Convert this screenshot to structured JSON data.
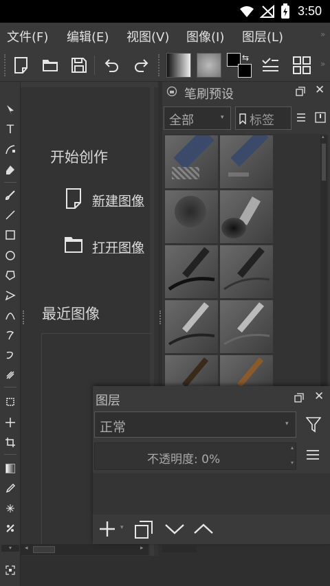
{
  "status": {
    "time": "3:50"
  },
  "menu": {
    "items": [
      "文件(F)",
      "编辑(E)",
      "视图(V)",
      "图像(I)",
      "图层(L)"
    ]
  },
  "welcome": {
    "start_title": "开始创作",
    "new_image": "新建图像",
    "open_image": "打开图像",
    "recent_title": "最近图像"
  },
  "brush_presets": {
    "title": "笔刷预设",
    "filter_value": "全部",
    "tag_label": "标签"
  },
  "layers": {
    "title": "图层",
    "blend_mode": "正常",
    "opacity_text": "不透明度:  0%"
  }
}
